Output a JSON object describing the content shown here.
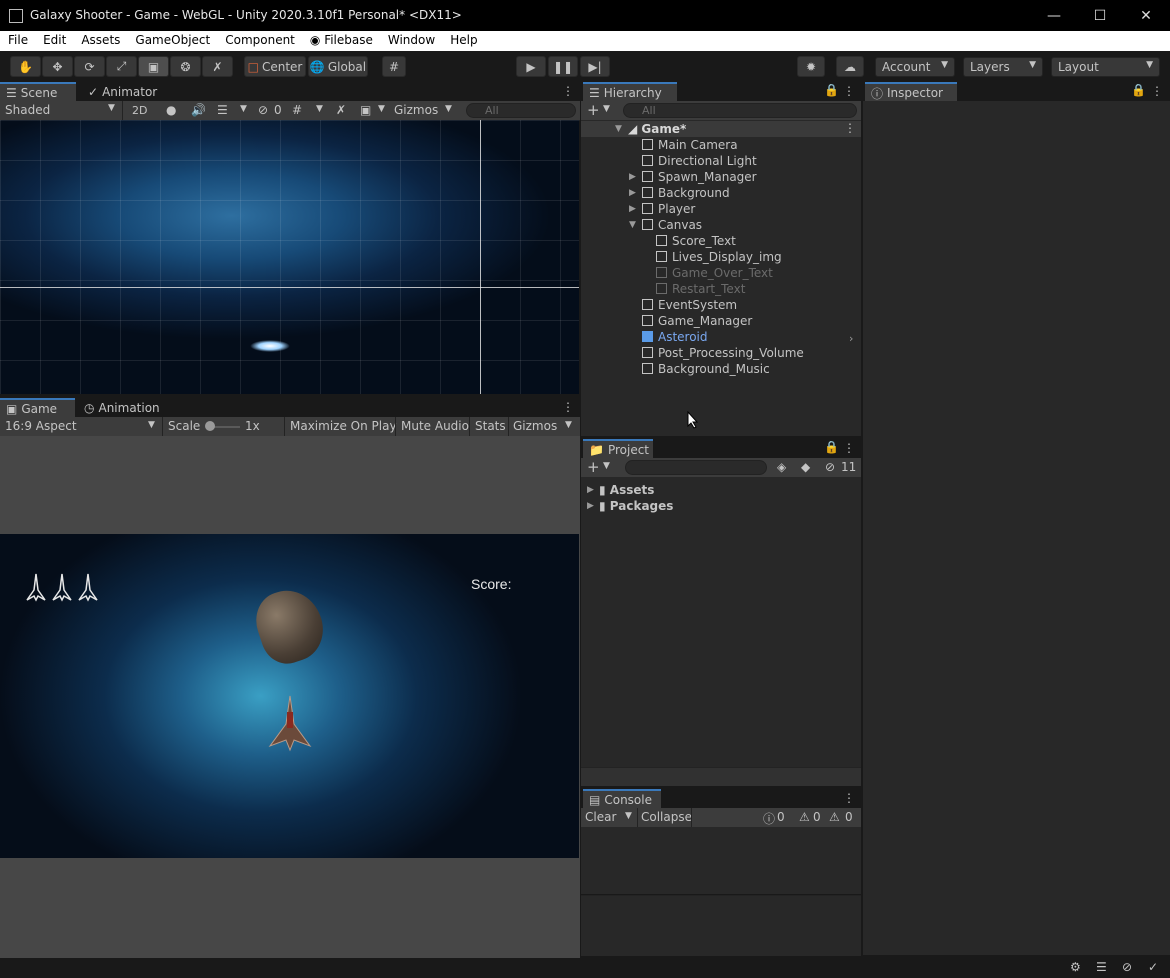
{
  "window": {
    "title": "Galaxy Shooter - Game - WebGL - Unity 2020.3.10f1 Personal* <DX11>"
  },
  "menu": [
    "File",
    "Edit",
    "Assets",
    "GameObject",
    "Component",
    "Filebase",
    "Window",
    "Help"
  ],
  "toolbar": {
    "center": "Center",
    "global": "Global",
    "account": "Account",
    "layers": "Layers",
    "layout": "Layout"
  },
  "scene": {
    "tab_scene": "Scene",
    "tab_animator": "Animator",
    "shading": "Shaded",
    "mode2d": "2D",
    "hidden_count": "0",
    "gizmos": "Gizmos",
    "search_placeholder": "All"
  },
  "game": {
    "tab_game": "Game",
    "tab_animation": "Animation",
    "aspect": "16:9 Aspect",
    "scale_label": "Scale",
    "scale_value": "1x",
    "maximize": "Maximize On Play",
    "mute": "Mute Audio",
    "stats": "Stats",
    "gizmos": "Gizmos",
    "score_text": "Score:"
  },
  "hierarchy": {
    "tab": "Hierarchy",
    "search_placeholder": "All",
    "scene_name": "Game*",
    "items": [
      "Main Camera",
      "Directional Light",
      "Spawn_Manager",
      "Background",
      "Player",
      "Canvas",
      "Score_Text",
      "Lives_Display_img",
      "Game_Over_Text",
      "Restart_Text",
      "EventSystem",
      "Game_Manager",
      "Asteroid",
      "Post_Processing_Volume",
      "Background_Music"
    ]
  },
  "project": {
    "tab": "Project",
    "hidden_count": "11",
    "folders": [
      "Assets",
      "Packages"
    ]
  },
  "console": {
    "tab": "Console",
    "clear": "Clear",
    "collapse": "Collapse",
    "log_count": "0",
    "warn_count": "0",
    "error_count": "0"
  },
  "inspector": {
    "tab": "Inspector"
  },
  "colors": {
    "accent": "#3a79bb",
    "prefab": "#7aa8f0",
    "panel": "#282828"
  }
}
